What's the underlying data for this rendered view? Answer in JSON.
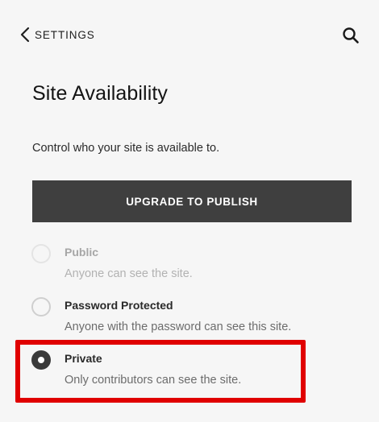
{
  "nav": {
    "back_label": "SETTINGS",
    "back_icon": "chevron-left-icon",
    "search_icon": "search-icon"
  },
  "page": {
    "title": "Site Availability",
    "description": "Control who your site is available to."
  },
  "upgrade_button": {
    "label": "UPGRADE TO PUBLISH"
  },
  "options": [
    {
      "label": "Public",
      "description": "Anyone can see the site.",
      "state": "disabled"
    },
    {
      "label": "Password Protected",
      "description": "Anyone with the password can see this site.",
      "state": "unselected"
    },
    {
      "label": "Private",
      "description": "Only contributors can see the site.",
      "state": "selected"
    }
  ],
  "colors": {
    "background": "#f6f6f6",
    "button_bg": "#3f3f3f",
    "highlight": "#e00000",
    "radio_checked": "#3a3a3a"
  }
}
